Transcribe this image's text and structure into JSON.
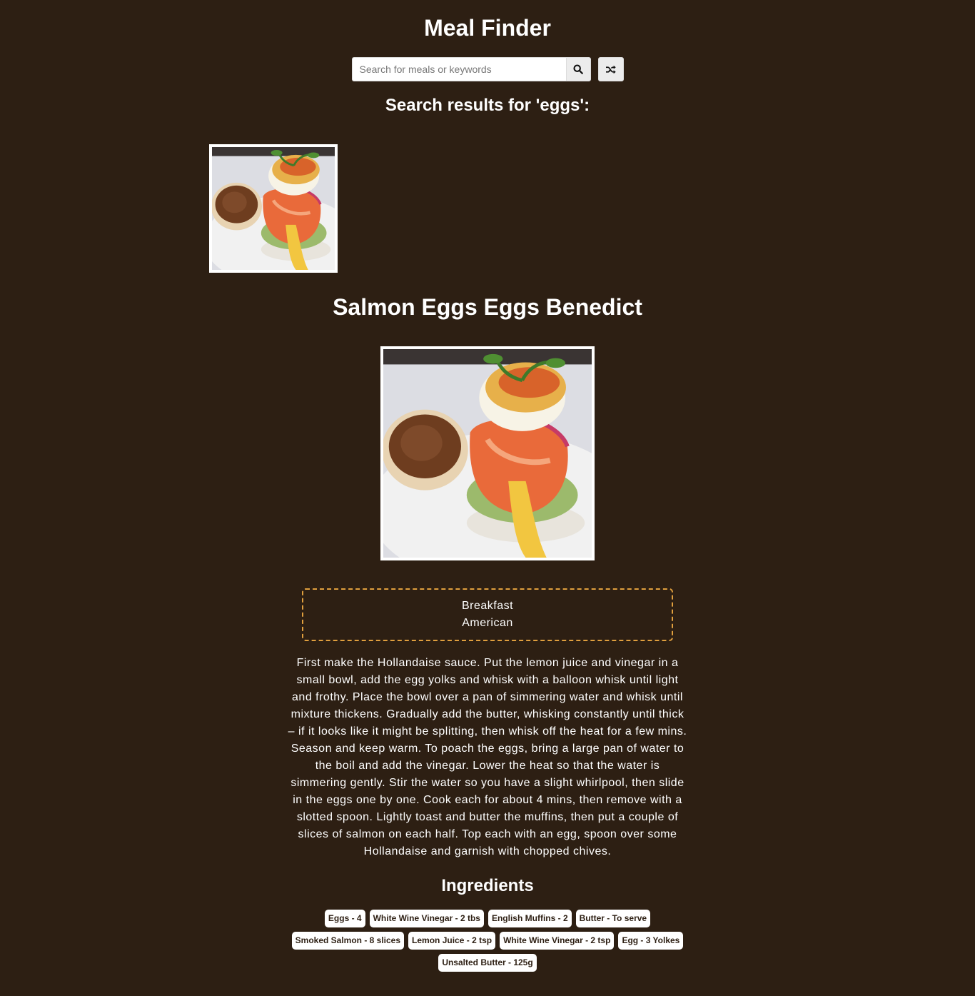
{
  "header": {
    "title": "Meal Finder"
  },
  "search": {
    "placeholder": "Search for meals or keywords",
    "value": "",
    "search_icon": "search-icon",
    "random_icon": "shuffle-icon"
  },
  "results": {
    "heading": "Search results for 'eggs':",
    "meals": [
      {
        "thumbnail": "eggs-benedict-salmon-photo"
      }
    ]
  },
  "meal": {
    "title": "Salmon Eggs Eggs Benedict",
    "image": "eggs-benedict-salmon-photo",
    "category": "Breakfast",
    "area": "American",
    "instructions": "First make the Hollandaise sauce. Put the lemon juice and vinegar in a small bowl, add the egg yolks and whisk with a balloon whisk until light and frothy. Place the bowl over a pan of simmering water and whisk until mixture thickens. Gradually add the butter, whisking constantly until thick – if it looks like it might be splitting, then whisk off the heat for a few mins. Season and keep warm. To poach the eggs, bring a large pan of water to the boil and add the vinegar. Lower the heat so that the water is simmering gently. Stir the water so you have a slight whirlpool, then slide in the eggs one by one. Cook each for about 4 mins, then remove with a slotted spoon. Lightly toast and butter the muffins, then put a couple of slices of salmon on each half. Top each with an egg, spoon over some Hollandaise and garnish with chopped chives.",
    "ingredients_heading": "Ingredients",
    "ingredients": [
      "Eggs - 4",
      "White Wine Vinegar - 2 tbs",
      "English Muffins - 2",
      "Butter - To serve",
      "Smoked Salmon - 8 slices",
      "Lemon Juice - 2 tsp",
      "White Wine Vinegar - 2 tsp",
      "Egg - 3 Yolkes",
      "Unsalted Butter - 125g"
    ]
  },
  "colors": {
    "background": "#2d1f13",
    "accent_border": "#e09f3e",
    "text": "#ffffff"
  }
}
